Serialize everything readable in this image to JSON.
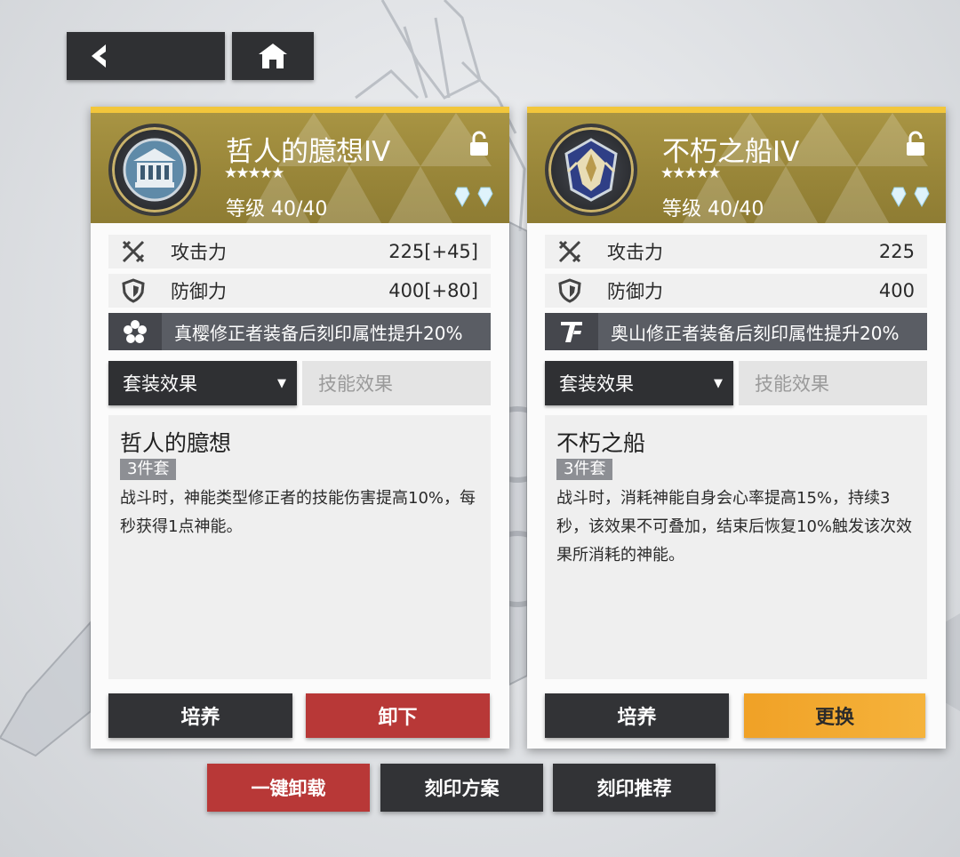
{
  "nav": {
    "back_icon": "chevron-left-icon",
    "home_icon": "home-icon"
  },
  "cards": [
    {
      "name": "哲人的臆想IV",
      "stars": "★★★★★",
      "level": "等级 40/40",
      "stats": [
        {
          "icon": "attack-icon",
          "label": "攻击力",
          "value": "225[+45]"
        },
        {
          "icon": "defense-icon",
          "label": "防御力",
          "value": "400[+80]"
        }
      ],
      "bonus": "真樱修正者装备后刻印属性提升20%",
      "tabs": {
        "set_effect": "套装效果",
        "skill_effect": "技能效果"
      },
      "set_name": "哲人的臆想",
      "set_badge": "3件套",
      "set_text": "战斗时，神能类型修正者的技能伤害提高10%，每秒获得1点神能。",
      "buttons": {
        "train": "培养",
        "action": "卸下"
      }
    },
    {
      "name": "不朽之船IV",
      "stars": "★★★★★",
      "level": "等级 40/40",
      "stats": [
        {
          "icon": "attack-icon",
          "label": "攻击力",
          "value": "225"
        },
        {
          "icon": "defense-icon",
          "label": "防御力",
          "value": "400"
        }
      ],
      "bonus": "奥山修正者装备后刻印属性提升20%",
      "tabs": {
        "set_effect": "套装效果",
        "skill_effect": "技能效果"
      },
      "set_name": "不朽之船",
      "set_badge": "3件套",
      "set_text": "战斗时，消耗神能自身会心率提高15%，持续3秒，该效果不可叠加，结束后恢复10%触发该次效果所消耗的神能。",
      "buttons": {
        "train": "培养",
        "action": "更换"
      }
    }
  ],
  "bottom": {
    "unload_all": "一键卸载",
    "plan": "刻印方案",
    "recommend": "刻印推荐"
  },
  "colors": {
    "gold": "#f2c63b",
    "header": "#998639",
    "red": "#b83837",
    "orange": "#f0a126",
    "dark": "#323336"
  }
}
